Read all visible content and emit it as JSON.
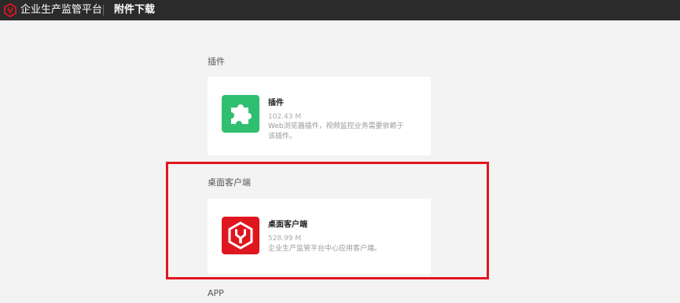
{
  "header": {
    "app_title": "企业生产监管平台",
    "page_name": "附件下载",
    "logo_icon": "shield-wrench-logo-icon",
    "accent_color": "#e0161f"
  },
  "sections": [
    {
      "title": "插件",
      "item": {
        "name": "插件",
        "size": "102.43 M",
        "description": "Web浏览器插件，视频监控业务需要依赖于该插件。",
        "icon": "puzzle-piece-icon",
        "icon_color": "#2fbf71"
      }
    },
    {
      "title": "桌面客户端",
      "item": {
        "name": "桌面客户端",
        "size": "528.99 M",
        "description": "企业生产监管平台中心应用客户端。",
        "icon": "shield-wrench-icon",
        "icon_color": "#e0161f"
      }
    },
    {
      "title": "APP"
    }
  ]
}
